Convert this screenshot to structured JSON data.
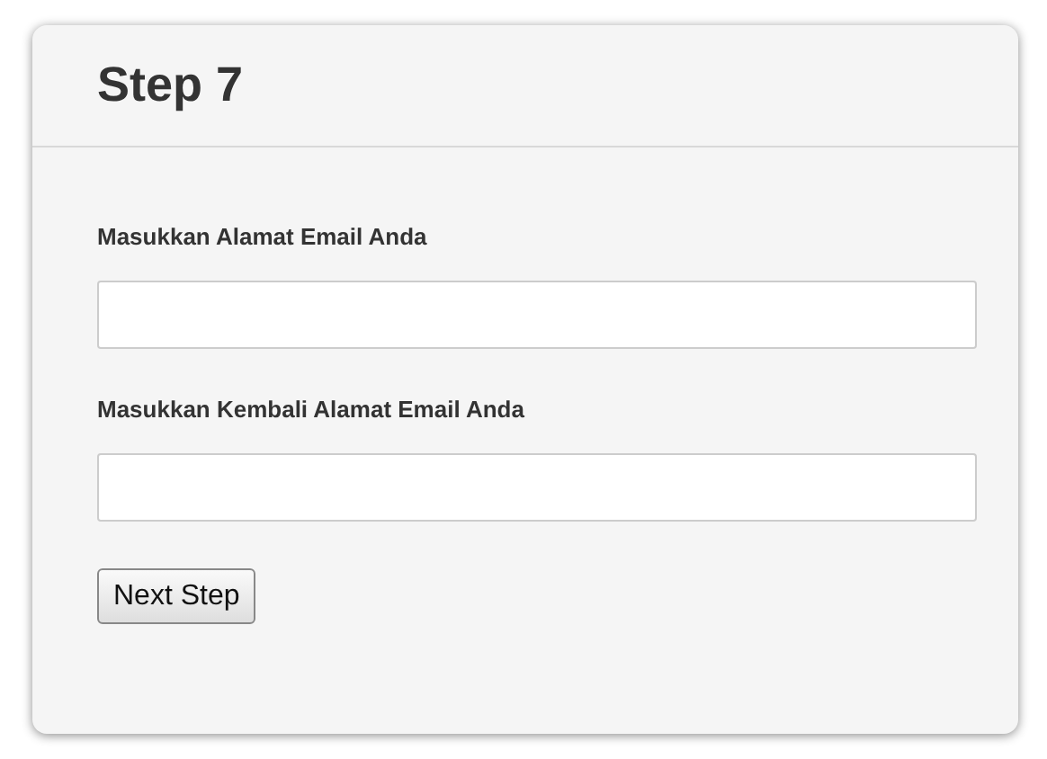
{
  "card": {
    "title": "Step 7"
  },
  "fields": [
    {
      "label": "Masukkan Alamat Email Anda"
    },
    {
      "label": "Masukkan Kembali Alamat Email Anda"
    }
  ],
  "button": {
    "label": "Next Step"
  }
}
